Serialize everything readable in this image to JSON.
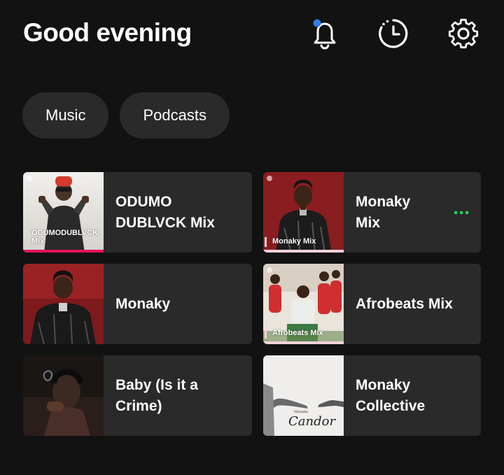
{
  "header": {
    "greeting": "Good evening",
    "icons": [
      "bell-icon",
      "recents-icon",
      "settings-icon"
    ],
    "notification_dot_color": "#2d7de7"
  },
  "filters": [
    {
      "label": "Music"
    },
    {
      "label": "Podcasts"
    }
  ],
  "shortcuts": [
    {
      "title": "ODUMO DUBLVCK Mix",
      "thumb_label": "ODUMODUBLVCK Mix",
      "thumb_bar_color": "#e8115b"
    },
    {
      "title": "Monaky Mix",
      "thumb_label": "Monaky Mix",
      "thumb_bar_color": "#f7d2d9",
      "now_playing": true
    },
    {
      "title": "Monaky"
    },
    {
      "title": "Afrobeats Mix",
      "thumb_label": "Afrobeats Mix",
      "thumb_bar_color": "#f7d2d9"
    },
    {
      "title": "Baby (Is it a Crime)"
    },
    {
      "title": "Monaky Collective",
      "thumb_art_text": "Candor",
      "thumb_art_small": "Monaky"
    }
  ],
  "colors": {
    "background": "#121212",
    "card": "#2a2a2a",
    "accent_green": "#1ed760"
  }
}
